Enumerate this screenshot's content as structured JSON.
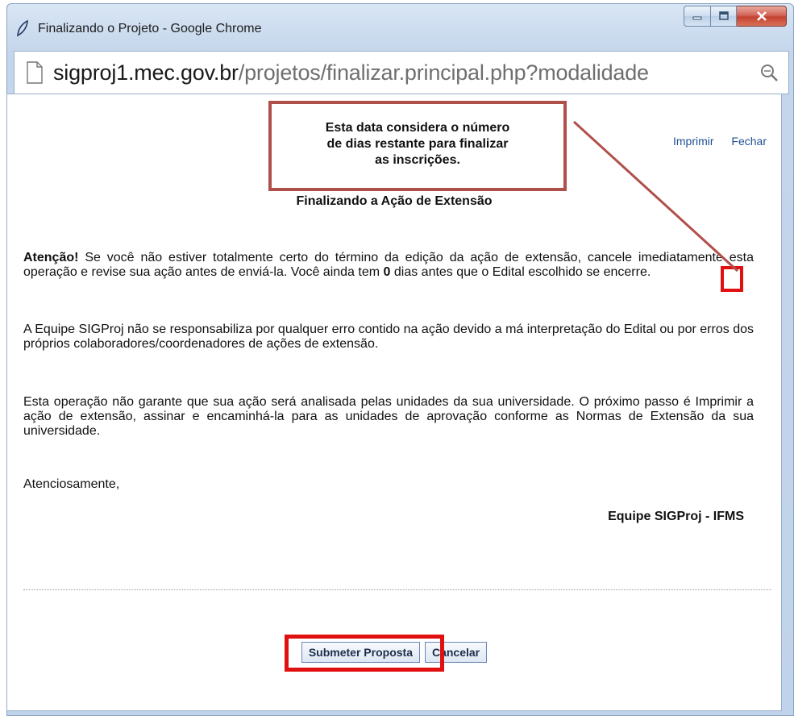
{
  "window": {
    "title": "Finalizando o Projeto - Google Chrome"
  },
  "address_bar": {
    "host": "sigproj1.mec.gov.br",
    "path": "/projetos/finalizar.principal.php?modalidade"
  },
  "links": {
    "print": "Imprimir",
    "close": "Fechar"
  },
  "page": {
    "heading": "Finalizando a Ação de Extensão",
    "warning_bold": "Atenção!",
    "warning_text": " Se você não estiver totalmente certo do término da edição da ação de extensão, cancele imediatamente esta operação e revise sua ação antes de enviá-la. Você ainda tem ",
    "days_remaining": "0",
    "warning_end": " dias antes que o Edital escolhido se encerre.",
    "paragraph2": "A Equipe SIGProj não se responsabiliza por qualquer erro contido na ação devido a má interpretação do Edital ou por erros dos próprios colaboradores/coordenadores de ações de extensão.",
    "paragraph3": "Esta operação não garante que sua ação será analisada pelas unidades da sua universidade. O próximo passo é Imprimir a ação de extensão, assinar e encaminhá-la para as unidades de aprovação conforme as Normas de Extensão da sua universidade.",
    "closing": "Atenciosamente,",
    "signature": "Equipe SIGProj - IFMS"
  },
  "buttons": {
    "submit": "Submeter Proposta",
    "cancel": "Cancelar"
  },
  "callout": {
    "line1": "Esta data considera o número",
    "line2": "de dias restante para finalizar",
    "line3": "as inscrições."
  },
  "colors": {
    "highlight": "#e01010",
    "callout_border": "#b0504a",
    "link": "#1f4e92"
  }
}
